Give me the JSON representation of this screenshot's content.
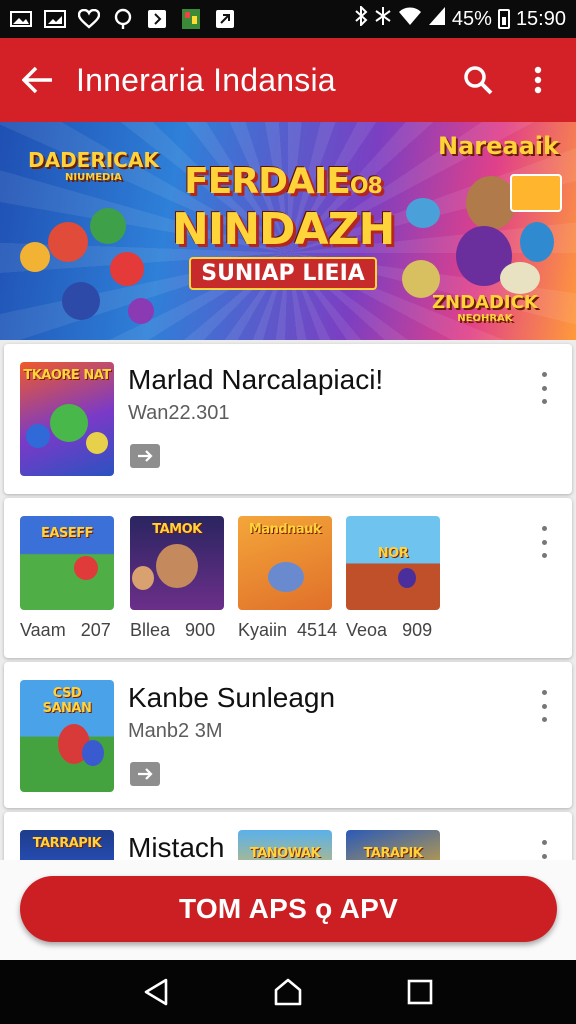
{
  "status_bar": {
    "icons_left": [
      "image-icon",
      "photo-icon",
      "heart-icon",
      "location-icon",
      "app-icon",
      "store-icon",
      "cast-icon"
    ],
    "battery": "45%",
    "time": "15:90"
  },
  "app_bar": {
    "title": "Inneraria Indansia",
    "back_icon": "arrow-left-icon",
    "search_icon": "search-icon",
    "menu_icon": "more-vertical-icon"
  },
  "banner": {
    "tag_left_line1": "DADERICAK",
    "tag_left_line2": "NIUMEDIA",
    "headline_line1": "FERDAIE",
    "headline_line1_suffix": "O8",
    "headline_line2": "NINDAZH",
    "headline_line3": "SUNIAP LIEIA",
    "tag_right_top": "Nareaaik",
    "tag_right_bottom_line1": "ZNDADICK",
    "tag_right_bottom_line2": "NEOHRAK"
  },
  "cards": [
    {
      "name": "Marlad Narcalapiaci!",
      "sub": "Wan22.301",
      "thumb_text": "TKAORE NAT"
    },
    {
      "items": [
        {
          "thumb_text": "EASEFF",
          "label": "Vaam",
          "count": "207"
        },
        {
          "thumb_text": "TAMOK",
          "label": "Bllea",
          "count": "900"
        },
        {
          "thumb_text": "Mandnauk",
          "label": "Kyaiin",
          "count": "4514"
        },
        {
          "thumb_text": "NOR",
          "label": "Veoa",
          "count": "909"
        }
      ]
    },
    {
      "name": "Kanbe Sunleagn",
      "sub": "Manb2 3M",
      "thumb_text": "CSD SANAN"
    },
    {
      "name": "Mistach",
      "thumb_text": "TARRAPIK",
      "extra_thumbs": [
        "TANOWAK",
        "TARAPIK"
      ]
    }
  ],
  "cta": {
    "label": "TOM APS ǫ APV"
  },
  "nav": {
    "back": "triangle-back-icon",
    "home": "home-icon",
    "recents": "square-recents-icon"
  },
  "colors": {
    "primary": "#d32127",
    "cta": "#cc1f24"
  }
}
